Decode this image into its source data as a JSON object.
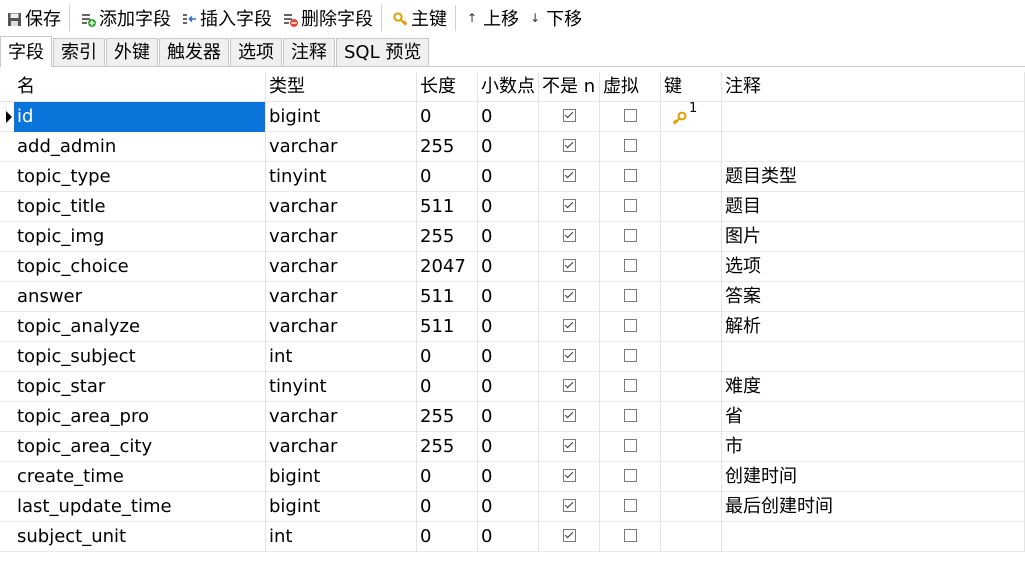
{
  "toolbar": {
    "save": "保存",
    "add_field": "添加字段",
    "insert_field": "插入字段",
    "delete_field": "删除字段",
    "primary_key": "主键",
    "move_up": "上移",
    "move_down": "下移"
  },
  "tabs": [
    "字段",
    "索引",
    "外键",
    "触发器",
    "选项",
    "注释",
    "SQL 预览"
  ],
  "columns": {
    "name": "名",
    "type": "类型",
    "length": "长度",
    "decimal": "小数点",
    "not_null": "不是 n",
    "virtual": "虚拟",
    "key": "键",
    "comment": "注释"
  },
  "rows": [
    {
      "name": "id",
      "type": "bigint",
      "length": "0",
      "decimal": "0",
      "not_null": true,
      "virtual": false,
      "key": "1",
      "comment": ""
    },
    {
      "name": "add_admin",
      "type": "varchar",
      "length": "255",
      "decimal": "0",
      "not_null": true,
      "virtual": false,
      "key": "",
      "comment": ""
    },
    {
      "name": "topic_type",
      "type": "tinyint",
      "length": "0",
      "decimal": "0",
      "not_null": true,
      "virtual": false,
      "key": "",
      "comment": "题目类型"
    },
    {
      "name": "topic_title",
      "type": "varchar",
      "length": "511",
      "decimal": "0",
      "not_null": true,
      "virtual": false,
      "key": "",
      "comment": "题目"
    },
    {
      "name": "topic_img",
      "type": "varchar",
      "length": "255",
      "decimal": "0",
      "not_null": true,
      "virtual": false,
      "key": "",
      "comment": "图片"
    },
    {
      "name": "topic_choice",
      "type": "varchar",
      "length": "2047",
      "decimal": "0",
      "not_null": true,
      "virtual": false,
      "key": "",
      "comment": "选项"
    },
    {
      "name": "answer",
      "type": "varchar",
      "length": "511",
      "decimal": "0",
      "not_null": true,
      "virtual": false,
      "key": "",
      "comment": "答案"
    },
    {
      "name": "topic_analyze",
      "type": "varchar",
      "length": "511",
      "decimal": "0",
      "not_null": true,
      "virtual": false,
      "key": "",
      "comment": "解析"
    },
    {
      "name": "topic_subject",
      "type": "int",
      "length": "0",
      "decimal": "0",
      "not_null": true,
      "virtual": false,
      "key": "",
      "comment": ""
    },
    {
      "name": "topic_star",
      "type": "tinyint",
      "length": "0",
      "decimal": "0",
      "not_null": true,
      "virtual": false,
      "key": "",
      "comment": "难度"
    },
    {
      "name": "topic_area_pro",
      "type": "varchar",
      "length": "255",
      "decimal": "0",
      "not_null": true,
      "virtual": false,
      "key": "",
      "comment": "省"
    },
    {
      "name": "topic_area_city",
      "type": "varchar",
      "length": "255",
      "decimal": "0",
      "not_null": true,
      "virtual": false,
      "key": "",
      "comment": "市"
    },
    {
      "name": "create_time",
      "type": "bigint",
      "length": "0",
      "decimal": "0",
      "not_null": true,
      "virtual": false,
      "key": "",
      "comment": "创建时间"
    },
    {
      "name": "last_update_time",
      "type": "bigint",
      "length": "0",
      "decimal": "0",
      "not_null": true,
      "virtual": false,
      "key": "",
      "comment": "最后创建时间"
    },
    {
      "name": "subject_unit",
      "type": "int",
      "length": "0",
      "decimal": "0",
      "not_null": true,
      "virtual": false,
      "key": "",
      "comment": ""
    }
  ],
  "icons": {
    "save": "floppy-disk-icon",
    "add_field": "add-field-icon",
    "insert_field": "insert-field-icon",
    "delete_field": "delete-field-icon",
    "primary_key": "key-icon",
    "move_up": "arrow-up-icon",
    "move_down": "arrow-down-icon"
  },
  "colors": {
    "selection": "#0a74da",
    "key_icon": "#e0a000",
    "add_green": "#2aa52a",
    "delete_red": "#e04b3a"
  }
}
